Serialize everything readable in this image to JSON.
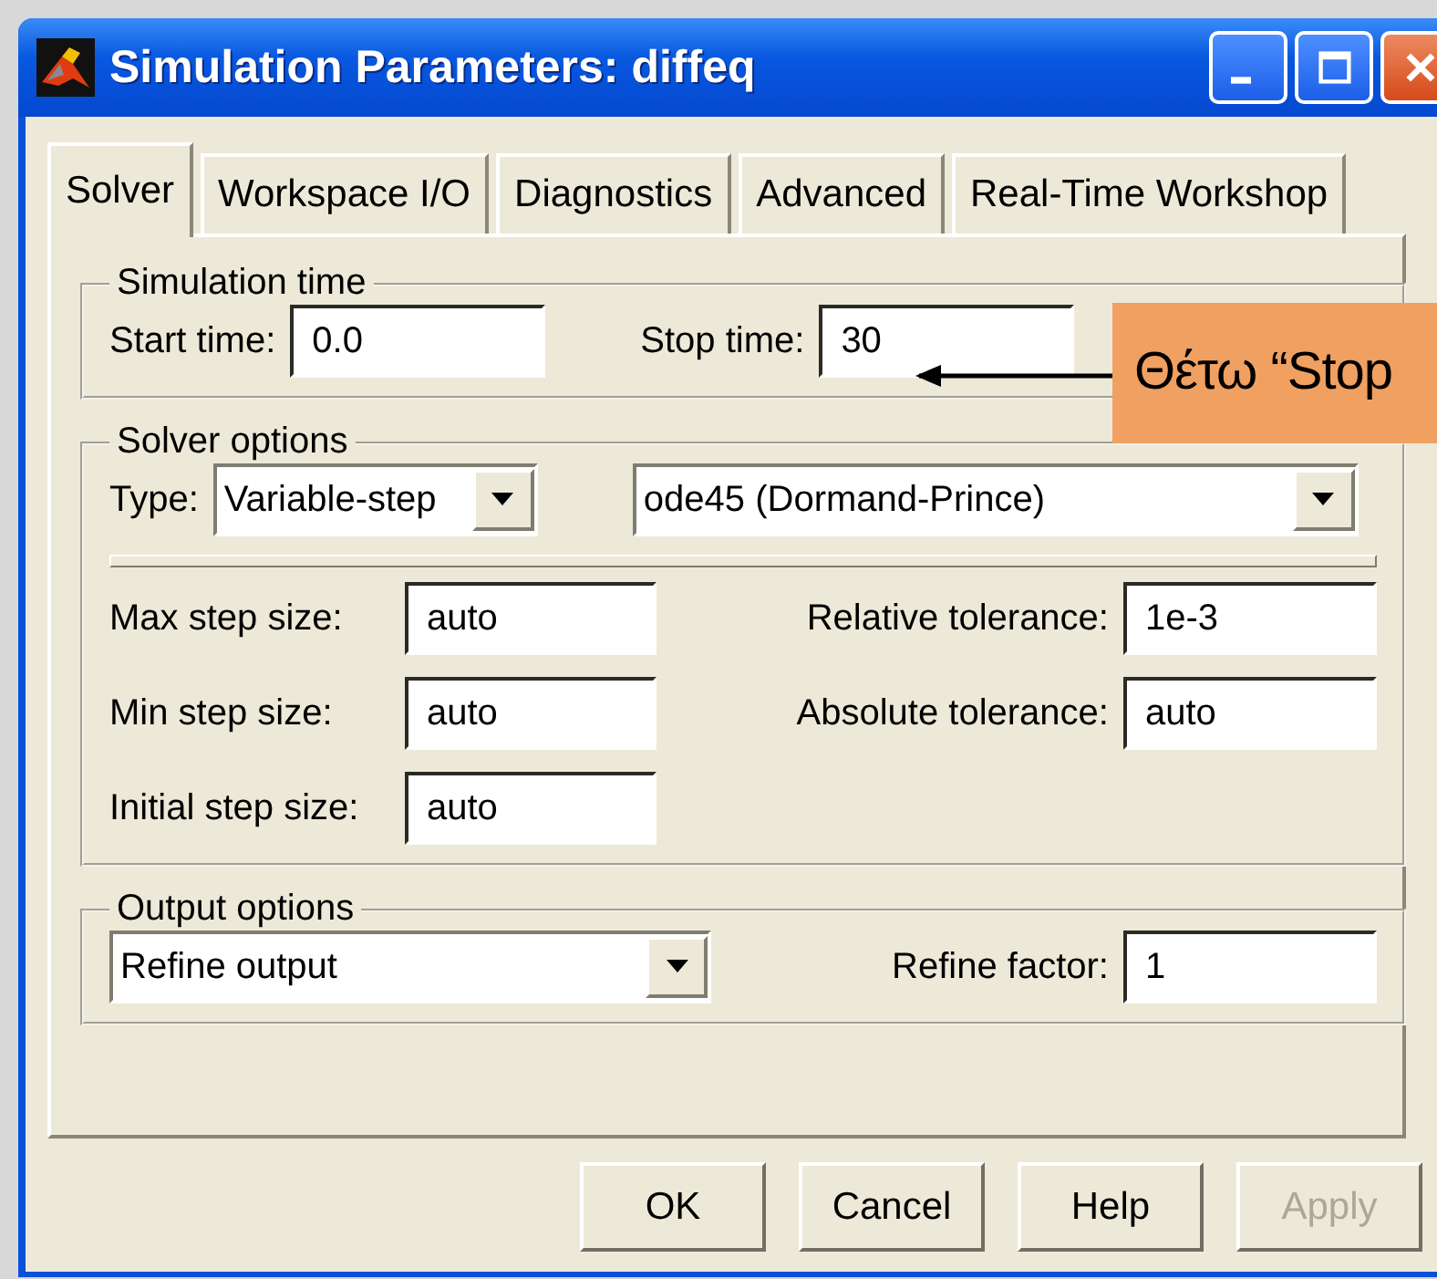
{
  "window": {
    "title": "Simulation Parameters:  diffeq"
  },
  "tabs": [
    {
      "label": "Solver",
      "selected": true
    },
    {
      "label": "Workspace I/O",
      "selected": false
    },
    {
      "label": "Diagnostics",
      "selected": false
    },
    {
      "label": "Advanced",
      "selected": false
    },
    {
      "label": "Real-Time Workshop",
      "selected": false
    }
  ],
  "simulation_time": {
    "legend": "Simulation time",
    "start_label": "Start time:",
    "start_value": "0.0",
    "stop_label": "Stop time:",
    "stop_value": "30"
  },
  "annotation": {
    "text": "Θέτω “Stop"
  },
  "solver_options": {
    "legend": "Solver options",
    "type_label": "Type:",
    "type_value": "Variable-step",
    "solver_value": "ode45 (Dormand-Prince)",
    "left_fields": [
      {
        "label": "Max step size:",
        "value": "auto"
      },
      {
        "label": "Min step size:",
        "value": "auto"
      },
      {
        "label": "Initial step size:",
        "value": "auto"
      }
    ],
    "right_fields": [
      {
        "label": "Relative tolerance:",
        "value": "1e-3"
      },
      {
        "label": "Absolute tolerance:",
        "value": "auto"
      }
    ]
  },
  "output_options": {
    "legend": "Output options",
    "mode_value": "Refine output",
    "factor_label": "Refine factor:",
    "factor_value": "1"
  },
  "buttons": [
    {
      "label": "OK",
      "disabled": false
    },
    {
      "label": "Cancel",
      "disabled": false
    },
    {
      "label": "Help",
      "disabled": false
    },
    {
      "label": "Apply",
      "disabled": true
    }
  ]
}
